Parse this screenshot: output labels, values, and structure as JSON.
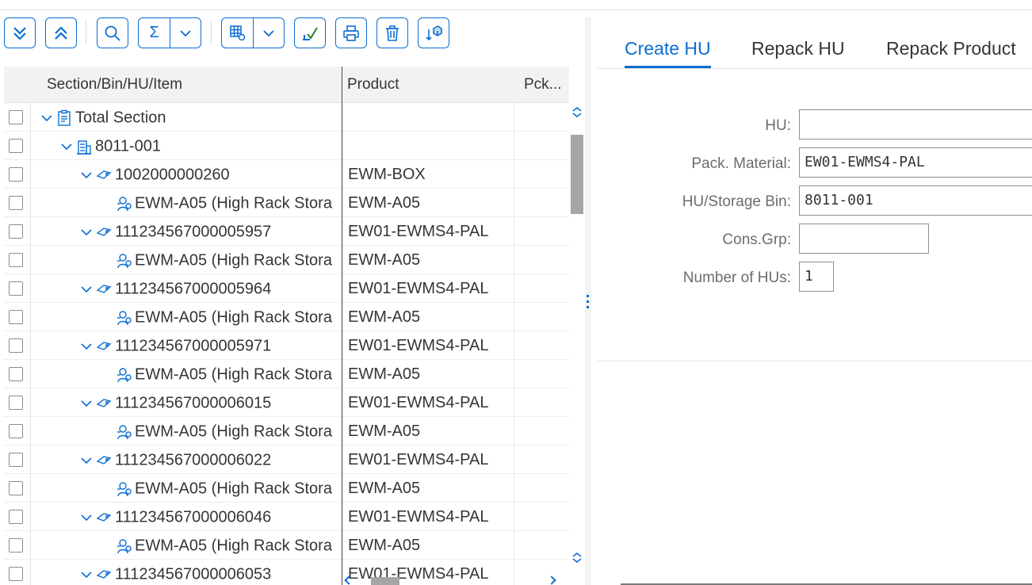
{
  "toolbar": {
    "buttons": [
      {
        "name": "expand-all",
        "icon": "double-chevron-down-icon"
      },
      {
        "name": "collapse-all",
        "icon": "double-chevron-up-icon"
      },
      {
        "name": "find",
        "icon": "search-icon"
      },
      {
        "name": "total",
        "icon": "sigma-icon"
      },
      {
        "name": "layout",
        "icon": "grid-settings-icon"
      },
      {
        "name": "check",
        "icon": "check-icon"
      },
      {
        "name": "print",
        "icon": "print-icon"
      },
      {
        "name": "delete",
        "icon": "trash-icon"
      },
      {
        "name": "pack",
        "icon": "package-download-icon"
      }
    ],
    "sigma": "Σ"
  },
  "tree": {
    "columns": [
      "Section/Bin/HU/Item",
      "Product",
      "Pck..."
    ],
    "rows": [
      {
        "level": 0,
        "expand": true,
        "icon": "section-icon",
        "label": "Total Section",
        "product": ""
      },
      {
        "level": 1,
        "expand": true,
        "icon": "bin-icon",
        "label": "8011-001",
        "product": ""
      },
      {
        "level": 2,
        "expand": true,
        "icon": "hu-icon",
        "label": "1002000000260",
        "product": "EWM-BOX"
      },
      {
        "level": 3,
        "expand": false,
        "icon": "product-icon",
        "label": "EWM-A05 (High Rack Stora",
        "product": "EWM-A05"
      },
      {
        "level": 2,
        "expand": true,
        "icon": "hu-icon",
        "label": "111234567000005957",
        "product": "EW01-EWMS4-PAL"
      },
      {
        "level": 3,
        "expand": false,
        "icon": "product-icon",
        "label": "EWM-A05 (High Rack Stora",
        "product": "EWM-A05"
      },
      {
        "level": 2,
        "expand": true,
        "icon": "hu-icon",
        "label": "111234567000005964",
        "product": "EW01-EWMS4-PAL"
      },
      {
        "level": 3,
        "expand": false,
        "icon": "product-icon",
        "label": "EWM-A05 (High Rack Stora",
        "product": "EWM-A05"
      },
      {
        "level": 2,
        "expand": true,
        "icon": "hu-icon",
        "label": "111234567000005971",
        "product": "EW01-EWMS4-PAL"
      },
      {
        "level": 3,
        "expand": false,
        "icon": "product-icon",
        "label": "EWM-A05 (High Rack Stora",
        "product": "EWM-A05"
      },
      {
        "level": 2,
        "expand": true,
        "icon": "hu-icon",
        "label": "111234567000006015",
        "product": "EW01-EWMS4-PAL"
      },
      {
        "level": 3,
        "expand": false,
        "icon": "product-icon",
        "label": "EWM-A05 (High Rack Stora",
        "product": "EWM-A05"
      },
      {
        "level": 2,
        "expand": true,
        "icon": "hu-icon",
        "label": "111234567000006022",
        "product": "EW01-EWMS4-PAL"
      },
      {
        "level": 3,
        "expand": false,
        "icon": "product-icon",
        "label": "EWM-A05 (High Rack Stora",
        "product": "EWM-A05"
      },
      {
        "level": 2,
        "expand": true,
        "icon": "hu-icon",
        "label": "111234567000006046",
        "product": "EW01-EWMS4-PAL"
      },
      {
        "level": 3,
        "expand": false,
        "icon": "product-icon",
        "label": "EWM-A05 (High Rack Stora",
        "product": "EWM-A05"
      },
      {
        "level": 2,
        "expand": true,
        "icon": "hu-icon",
        "label": "111234567000006053",
        "product": "EW01-EWMS4-PAL"
      }
    ]
  },
  "tabs": [
    "Create HU",
    "Repack HU",
    "Repack Product"
  ],
  "form": {
    "hu_label": "HU:",
    "hu_value": "",
    "pack_material_label": "Pack. Material:",
    "pack_material_value": "EW01-EWMS4-PAL",
    "storage_bin_label": "HU/Storage Bin:",
    "storage_bin_value": "8011-001",
    "cons_grp_label": "Cons.Grp:",
    "cons_grp_value": "",
    "num_hus_label": "Number of HUs:",
    "num_hus_value": "1"
  },
  "colors": {
    "accent": "#0a6ed1",
    "text": "#32363a",
    "label": "#6a6d70"
  }
}
